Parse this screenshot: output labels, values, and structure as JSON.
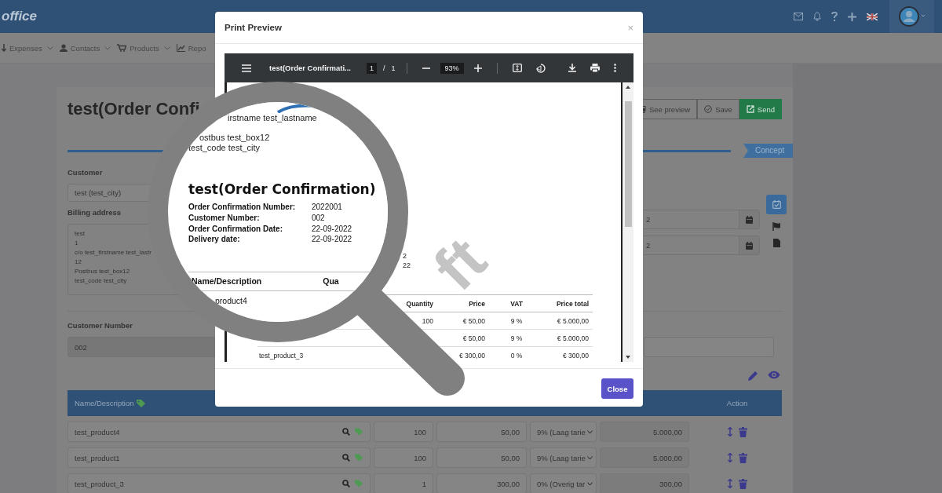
{
  "app": {
    "logo": "office",
    "nav": [
      "Expenses",
      "Contacts",
      "Products",
      "Repo"
    ]
  },
  "document": {
    "title": "test(Order Confi",
    "buttons": [
      {
        "label": "See preview",
        "kind": "outline"
      },
      {
        "label": "Save",
        "kind": "outline"
      },
      {
        "label": "Send",
        "kind": "primary"
      }
    ],
    "status": "Concept",
    "customer": {
      "label": "Customer",
      "value": "test (test_city)"
    },
    "billing": {
      "label": "Billing address",
      "lines": [
        "test",
        "1",
        "c/o test_firstname test_lastr",
        "12",
        "Postbus test_box12",
        "test_code test_city"
      ]
    },
    "dates": [
      "2",
      "2"
    ],
    "customer_number": {
      "label": "Customer Number",
      "value": "002"
    },
    "table": {
      "columns": [
        "Name/Description",
        "Action"
      ],
      "rows": [
        {
          "name": "test_product4",
          "quantity": "100",
          "price": "50,00",
          "vat": "9% (Laag tarie",
          "total": "5.000,00"
        },
        {
          "name": "test_product1",
          "quantity": "100",
          "price": "50,00",
          "vat": "9% (Laag tarie",
          "total": "5.000,00"
        },
        {
          "name": "test_product_3",
          "quantity": "1",
          "price": "300,00",
          "vat": "0% (Overig tar",
          "total": "300,00"
        }
      ]
    }
  },
  "modal": {
    "title": "Print Preview",
    "close": "×",
    "viewer": {
      "file": "test(Order Confirmati...",
      "page": "1",
      "separator": "/",
      "pages": "1",
      "zoom": "93%"
    },
    "page": {
      "fragments": [
        "2",
        "22"
      ],
      "watermark": "ft",
      "columns": [
        "Quantity",
        "Price",
        "VAT",
        "Price total"
      ],
      "rows": [
        {
          "quantity": "100",
          "price": "€ 50,00",
          "vat": "9 %",
          "total": "€ 5.000,00"
        },
        {
          "price": "€ 50,00",
          "vat": "9 %",
          "total": "€ 5.000,00"
        },
        {
          "name": "test_product_3",
          "price": "€ 300,00",
          "vat": "0 %",
          "total": "€ 300,00"
        }
      ]
    },
    "close_button": "Close"
  },
  "lens": {
    "address": [
      "irstname test_lastname",
      "ostbus test_box12",
      "test_code test_city"
    ],
    "title": "test(Order Confirmation)",
    "fields": [
      {
        "label": "Order Confirmation Number:",
        "value": "2022001"
      },
      {
        "label": "Customer Number:",
        "value": "002"
      },
      {
        "label": "Order Confirmation Date:",
        "value": "22-09-2022"
      },
      {
        "label": "Delivery date:",
        "value": "22-09-2022"
      }
    ],
    "columns": [
      "Name/Description",
      "Qua"
    ],
    "first_item": "product4"
  }
}
